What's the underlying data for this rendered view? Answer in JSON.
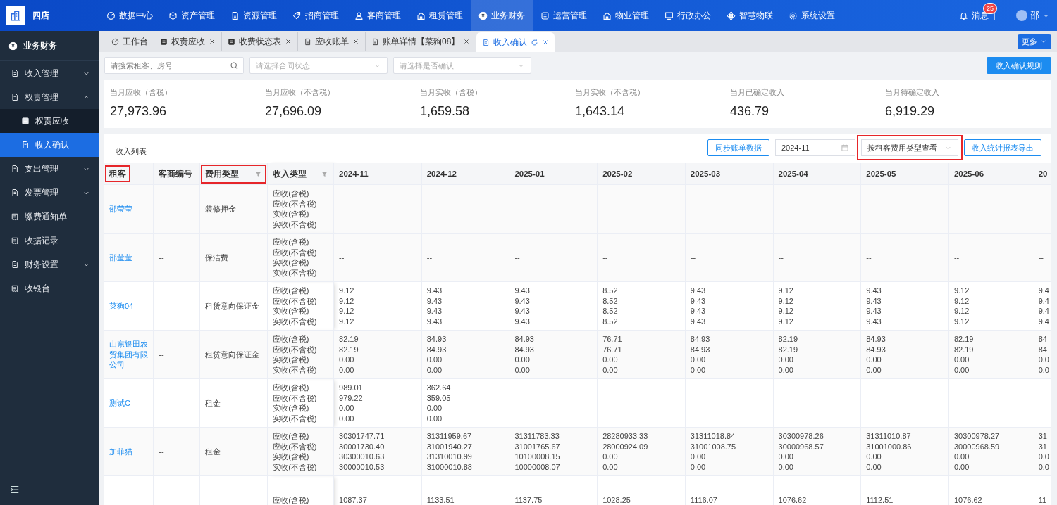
{
  "topbar": {
    "store_name": "四店",
    "nav": [
      {
        "label": "数据中心",
        "selected": false
      },
      {
        "label": "资产管理",
        "selected": false
      },
      {
        "label": "资源管理",
        "selected": false
      },
      {
        "label": "招商管理",
        "selected": false
      },
      {
        "label": "客商管理",
        "selected": false
      },
      {
        "label": "租赁管理",
        "selected": false
      },
      {
        "label": "业务财务",
        "selected": true
      },
      {
        "label": "运营管理",
        "selected": false
      },
      {
        "label": "物业管理",
        "selected": false
      },
      {
        "label": "行政办公",
        "selected": false
      },
      {
        "label": "智慧物联",
        "selected": false
      },
      {
        "label": "系统设置",
        "selected": false
      }
    ],
    "messages": {
      "label": "消息",
      "count": "25"
    },
    "user": {
      "name": "邵"
    }
  },
  "sidebar": {
    "title": "业务财务",
    "items": [
      {
        "kind": "group",
        "label": "收入管理",
        "expanded": false
      },
      {
        "kind": "group",
        "label": "权责管理",
        "expanded": true,
        "children": [
          {
            "label": "权责应收",
            "selected": false
          },
          {
            "label": "收入确认",
            "selected": true
          }
        ]
      },
      {
        "kind": "group",
        "label": "支出管理",
        "expanded": false
      },
      {
        "kind": "group",
        "label": "发票管理",
        "expanded": false
      },
      {
        "kind": "link",
        "label": "缴费通知单",
        "selected": false
      },
      {
        "kind": "link",
        "label": "收据记录",
        "selected": false
      },
      {
        "kind": "group",
        "label": "财务设置",
        "expanded": false
      },
      {
        "kind": "link",
        "label": "收银台",
        "selected": false
      }
    ]
  },
  "tabs": [
    {
      "label": "工作台",
      "selected": false,
      "closable": false
    },
    {
      "label": "权责应收",
      "selected": false,
      "closable": true
    },
    {
      "label": "收费状态表",
      "selected": false,
      "closable": true
    },
    {
      "label": "应收账单",
      "selected": false,
      "closable": true
    },
    {
      "label": "账单详情【菜狗08】",
      "selected": false,
      "closable": true
    },
    {
      "label": "收入确认",
      "selected": true,
      "closable": true
    }
  ],
  "more_button": "更多",
  "filters": {
    "search": {
      "placeholder": "请搜索租客、房号"
    },
    "contract_status": {
      "placeholder": "请选择合同状态"
    },
    "confirmed": {
      "placeholder": "请选择是否确认"
    },
    "rule_button": "收入确认规则"
  },
  "stats": [
    {
      "label": "当月应收（含税）",
      "value": "27,973.96"
    },
    {
      "label": "当月应收（不含税）",
      "value": "27,696.09"
    },
    {
      "label": "当月实收（含税）",
      "value": "1,659.58"
    },
    {
      "label": "当月实收（不含税）",
      "value": "1,643.14"
    },
    {
      "label": "当月已确定收入",
      "value": "436.79"
    },
    {
      "label": "当月待确定收入",
      "value": "6,919.29"
    }
  ],
  "income_list": {
    "title": "收入列表",
    "sync_button": "同步账单数据",
    "month_picker": {
      "value": "2024-11"
    },
    "view_select": {
      "value": "按租客费用类型查看",
      "annotated": true
    },
    "export_button": "收入统计报表导出"
  },
  "table": {
    "columns": [
      {
        "label": "租客",
        "kind": "fixed",
        "filter": false,
        "annotated": true
      },
      {
        "label": "客商编号",
        "kind": "fixed",
        "filter": false,
        "annotated": false
      },
      {
        "label": "费用类型",
        "kind": "fixed",
        "filter": true,
        "annotated": true
      },
      {
        "label": "收入类型",
        "kind": "fixed",
        "filter": true,
        "annotated": false
      },
      {
        "label": "2024-11",
        "kind": "month",
        "filter": false,
        "annotated": false
      },
      {
        "label": "2024-12",
        "kind": "month",
        "filter": false,
        "annotated": false
      },
      {
        "label": "2025-01",
        "kind": "month",
        "filter": false,
        "annotated": false
      },
      {
        "label": "2025-02",
        "kind": "month",
        "filter": false,
        "annotated": false
      },
      {
        "label": "2025-03",
        "kind": "month",
        "filter": false,
        "annotated": false
      },
      {
        "label": "2025-04",
        "kind": "month",
        "filter": false,
        "annotated": false
      },
      {
        "label": "2025-05",
        "kind": "month",
        "filter": false,
        "annotated": false
      },
      {
        "label": "2025-06",
        "kind": "month",
        "filter": false,
        "annotated": false
      },
      {
        "label": "20",
        "kind": "partial",
        "filter": false,
        "annotated": false
      }
    ],
    "rows": [
      {
        "tenant": "邵莹莹",
        "merchant_code": "--",
        "fee_type": "装修押金",
        "income_types": [
          "应收(含税)",
          "应收(不含税)",
          "实收(含税)",
          "实收(不含税)"
        ],
        "values": [
          [
            "--"
          ],
          [
            "--"
          ],
          [
            "--"
          ],
          [
            "--"
          ],
          [
            "--"
          ],
          [
            "--"
          ],
          [
            "--"
          ],
          [
            "--"
          ],
          [
            "--"
          ]
        ]
      },
      {
        "tenant": "邵莹莹",
        "merchant_code": "--",
        "fee_type": "保洁费",
        "income_types": [
          "应收(含税)",
          "应收(不含税)",
          "实收(含税)",
          "实收(不含税)"
        ],
        "values": [
          [
            "--"
          ],
          [
            "--"
          ],
          [
            "--"
          ],
          [
            "--"
          ],
          [
            "--"
          ],
          [
            "--"
          ],
          [
            "--"
          ],
          [
            "--"
          ],
          [
            "--"
          ]
        ]
      },
      {
        "tenant": "菜狗04",
        "merchant_code": "--",
        "fee_type": "租赁意向保证金",
        "income_types": [
          "应收(含税)",
          "应收(不含税)",
          "实收(含税)",
          "实收(不含税)"
        ],
        "values": [
          [
            "9.12",
            "9.12",
            "9.12",
            "9.12"
          ],
          [
            "9.43",
            "9.43",
            "9.43",
            "9.43"
          ],
          [
            "9.43",
            "9.43",
            "9.43",
            "9.43"
          ],
          [
            "8.52",
            "8.52",
            "8.52",
            "8.52"
          ],
          [
            "9.43",
            "9.43",
            "9.43",
            "9.43"
          ],
          [
            "9.12",
            "9.12",
            "9.12",
            "9.12"
          ],
          [
            "9.43",
            "9.43",
            "9.43",
            "9.43"
          ],
          [
            "9.12",
            "9.12",
            "9.12",
            "9.12"
          ],
          [
            "9.4",
            "9.4",
            "9.4",
            "9.4"
          ]
        ]
      },
      {
        "tenant": "山东银田农贸集团有限公司",
        "merchant_code": "--",
        "fee_type": "租赁意向保证金",
        "income_types": [
          "应收(含税)",
          "应收(不含税)",
          "实收(含税)",
          "实收(不含税)"
        ],
        "values": [
          [
            "82.19",
            "82.19",
            "0.00",
            "0.00"
          ],
          [
            "84.93",
            "84.93",
            "0.00",
            "0.00"
          ],
          [
            "84.93",
            "84.93",
            "0.00",
            "0.00"
          ],
          [
            "76.71",
            "76.71",
            "0.00",
            "0.00"
          ],
          [
            "84.93",
            "84.93",
            "0.00",
            "0.00"
          ],
          [
            "82.19",
            "82.19",
            "0.00",
            "0.00"
          ],
          [
            "84.93",
            "84.93",
            "0.00",
            "0.00"
          ],
          [
            "82.19",
            "82.19",
            "0.00",
            "0.00"
          ],
          [
            "84",
            "84",
            "0.0",
            "0.0"
          ]
        ]
      },
      {
        "tenant": "测试C",
        "merchant_code": "--",
        "fee_type": "租金",
        "income_types": [
          "应收(含税)",
          "应收(不含税)",
          "实收(含税)",
          "实收(不含税)"
        ],
        "values": [
          [
            "989.01",
            "979.22",
            "0.00",
            "0.00"
          ],
          [
            "362.64",
            "359.05",
            "0.00",
            "0.00"
          ],
          [
            "--"
          ],
          [
            "--"
          ],
          [
            "--"
          ],
          [
            "--"
          ],
          [
            "--"
          ],
          [
            "--"
          ],
          [
            "--"
          ]
        ]
      },
      {
        "tenant": "加菲猫",
        "merchant_code": "--",
        "fee_type": "租金",
        "income_types": [
          "应收(含税)",
          "应收(不含税)",
          "实收(含税)",
          "实收(不含税)"
        ],
        "values": [
          [
            "30301747.71",
            "30001730.40",
            "30300010.63",
            "30000010.53"
          ],
          [
            "31311959.67",
            "31001940.27",
            "31310010.99",
            "31000010.88"
          ],
          [
            "31311783.33",
            "31001765.67",
            "10100008.15",
            "10000008.07"
          ],
          [
            "28280933.33",
            "28000924.09",
            "0.00",
            "0.00"
          ],
          [
            "31311018.84",
            "31001008.75",
            "0.00",
            "0.00"
          ],
          [
            "30300978.26",
            "30000968.57",
            "0.00",
            "0.00"
          ],
          [
            "31311010.87",
            "31001000.86",
            "0.00",
            "0.00"
          ],
          [
            "30300978.27",
            "30000968.59",
            "0.00",
            "0.00"
          ],
          [
            "31",
            "31",
            "0.0",
            "0.0"
          ]
        ]
      },
      {
        "income_types": [
          "应收(含税)"
        ],
        "values": [
          [
            "1087.37"
          ],
          [
            "1133.51"
          ],
          [
            "1137.75"
          ],
          [
            "1028.25"
          ],
          [
            "1116.07"
          ],
          [
            "1076.62"
          ],
          [
            "1112.51"
          ],
          [
            "1076.62"
          ],
          [
            "11"
          ]
        ]
      }
    ]
  }
}
